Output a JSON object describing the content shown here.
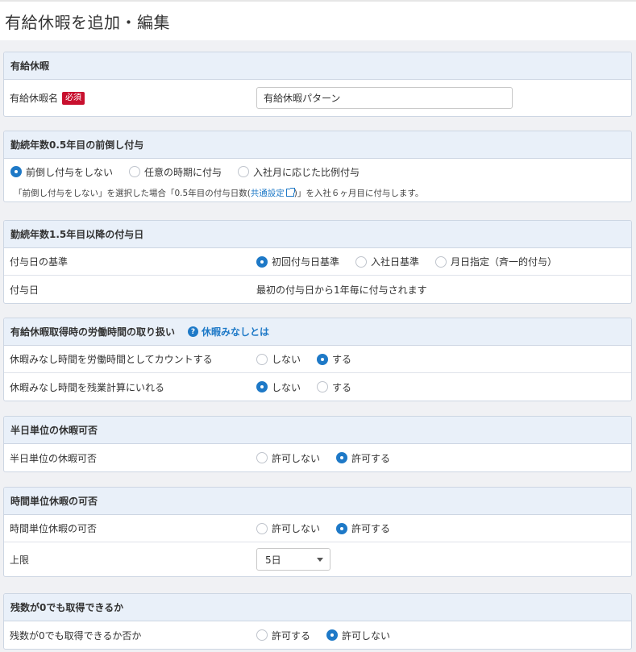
{
  "page": {
    "title": "有給休暇を追加・編集"
  },
  "s1": {
    "title": "有給休暇",
    "name_label": "有給休暇名",
    "required": "必須",
    "name_value": "有給休暇パターン"
  },
  "s2": {
    "title": "勤続年数0.5年目の前倒し付与",
    "options": [
      "前倒し付与をしない",
      "任意の時期に付与",
      "入社月に応じた比例付与"
    ],
    "note_pre": "「前倒し付与をしない」を選択した場合「0.5年目の付与日数(",
    "note_link": "共通設定",
    "note_post": ")」を入社６ヶ月目に付与します。"
  },
  "s3": {
    "title": "勤続年数1.5年目以降の付与日",
    "basis_label": "付与日の基準",
    "basis_options": [
      "初回付与日基準",
      "入社日基準",
      "月日指定（斉一的付与）"
    ],
    "date_label": "付与日",
    "date_value": "最初の付与日から1年毎に付与されます"
  },
  "s4": {
    "title": "有給休暇取得時の労働時間の取り扱い",
    "help_link": "休暇みなしとは",
    "row1_label": "休暇みなし時間を労働時間としてカウントする",
    "row2_label": "休暇みなし時間を残業計算にいれる",
    "no": "しない",
    "yes": "する"
  },
  "s5": {
    "title": "半日単位の休暇可否",
    "row_label": "半日単位の休暇可否",
    "deny": "許可しない",
    "allow": "許可する"
  },
  "s6": {
    "title": "時間単位休暇の可否",
    "row_label": "時間単位休暇の可否",
    "deny": "許可しない",
    "allow": "許可する",
    "limit_label": "上限",
    "limit_value": "5日"
  },
  "s7": {
    "title": "残数が0でも取得できるか",
    "row_label": "残数が0でも取得できるか否か",
    "allow": "許可する",
    "deny": "許可しない"
  },
  "colors": {
    "accent": "#1e79c7",
    "required": "#c8102e",
    "section_head": "#e9f0f9"
  }
}
